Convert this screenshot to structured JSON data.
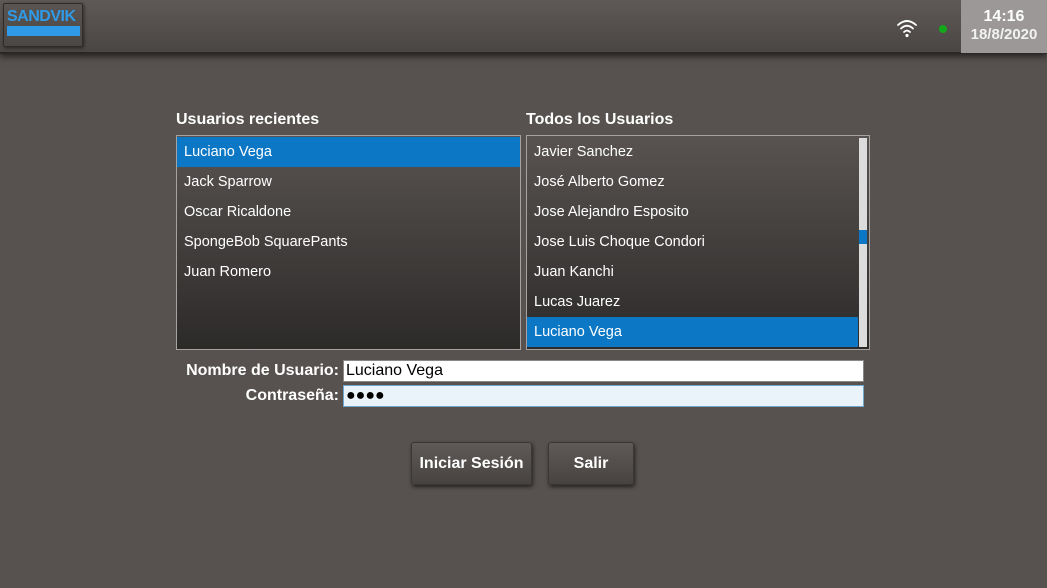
{
  "header": {
    "logo_text": "SANDVIK",
    "clock": {
      "time": "14:16",
      "date": "18/8/2020"
    },
    "status_color": "#13a81a",
    "icons": [
      "wifi-icon",
      "status-dot"
    ]
  },
  "recent_users": {
    "title": "Usuarios recientes",
    "items": [
      {
        "label": "Luciano Vega",
        "selected": true
      },
      {
        "label": "Jack Sparrow",
        "selected": false
      },
      {
        "label": "Oscar Ricaldone",
        "selected": false
      },
      {
        "label": "SpongeBob SquarePants",
        "selected": false
      },
      {
        "label": "Juan Romero",
        "selected": false
      }
    ]
  },
  "all_users": {
    "title": "Todos los Usuarios",
    "items": [
      {
        "label": "Javier Sanchez",
        "selected": false
      },
      {
        "label": "José Alberto Gomez",
        "selected": false
      },
      {
        "label": "Jose Alejandro Esposito",
        "selected": false
      },
      {
        "label": "Jose Luis Choque Condori",
        "selected": false
      },
      {
        "label": "Juan Kanchi",
        "selected": false
      },
      {
        "label": "Lucas Juarez",
        "selected": false
      },
      {
        "label": "Luciano Vega",
        "selected": true
      }
    ]
  },
  "form": {
    "username_label": "Nombre de Usuario:",
    "username_value": "Luciano Vega",
    "password_label": "Contraseña:",
    "password_value": "●●●●"
  },
  "buttons": {
    "login": "Iniciar Sesión",
    "exit": "Salir"
  },
  "colors": {
    "accent": "#0b77c5",
    "background": "#575250",
    "logo": "#2f9ae8"
  }
}
